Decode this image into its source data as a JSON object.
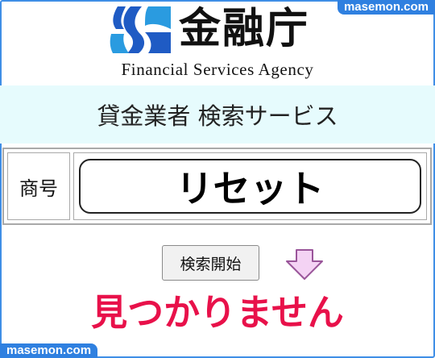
{
  "watermark": {
    "top": "masemon.com",
    "bottom": "masemon.com"
  },
  "logo": {
    "kanji": "金融庁",
    "english": "Financial Services Agency"
  },
  "banner": {
    "title": "貸金業者 検索サービス"
  },
  "form": {
    "label": "商号",
    "input_value": "リセット"
  },
  "search_button": {
    "label": "検索開始"
  },
  "result": {
    "message": "見つかりません"
  },
  "colors": {
    "accent_blue": "#1f5bc4",
    "banner_bg": "#e6fbfd",
    "result_red": "#e8114a",
    "arrow_fill": "#f4d3f4",
    "arrow_stroke": "#9a559a"
  }
}
